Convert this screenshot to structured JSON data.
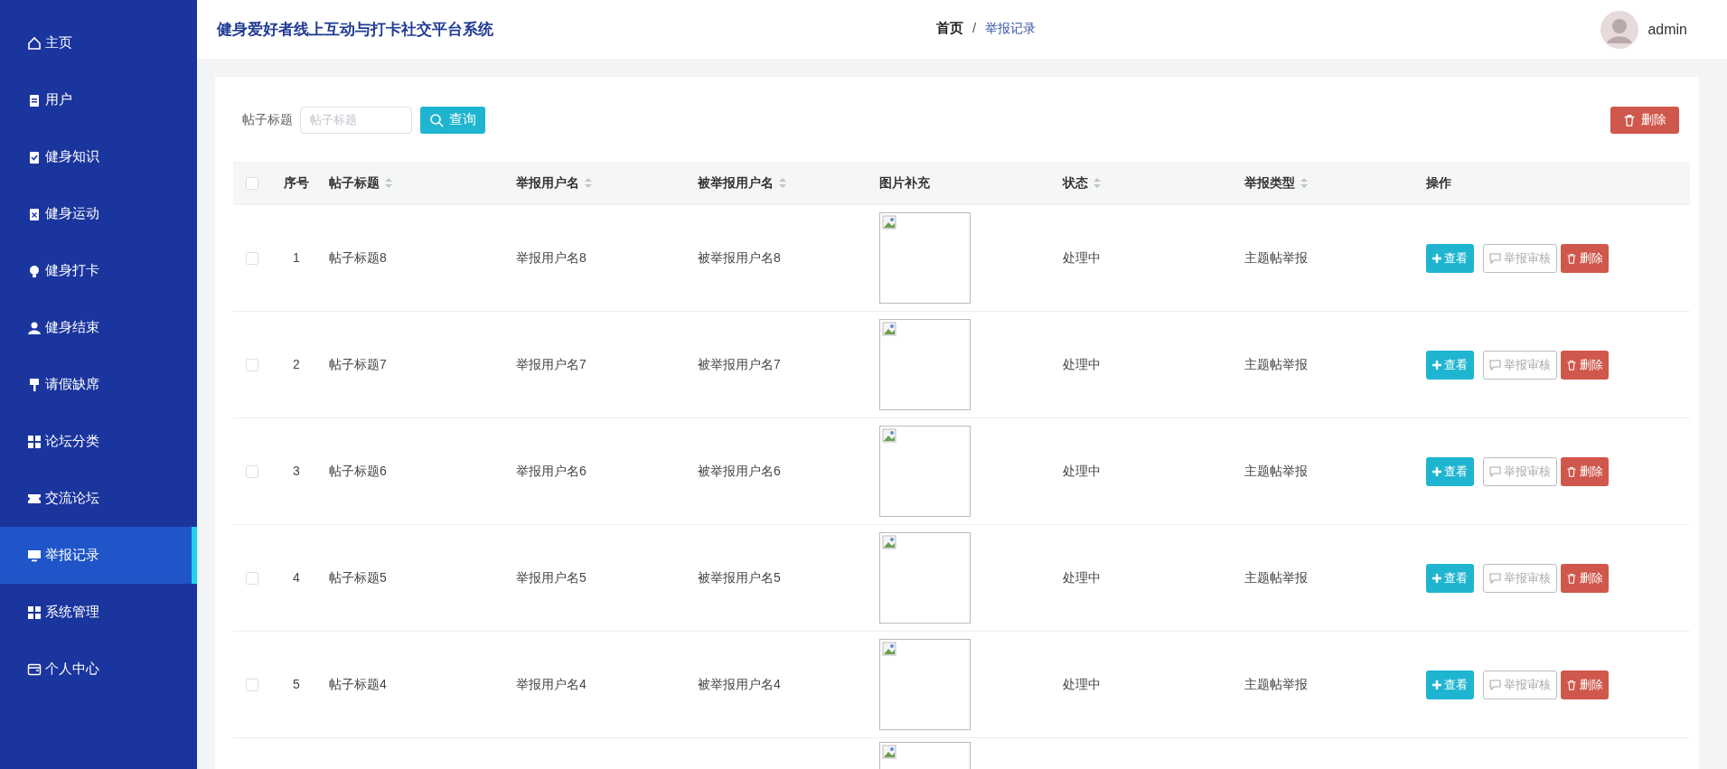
{
  "sidebar": {
    "items": [
      {
        "label": "主页",
        "selected": false
      },
      {
        "label": "用户",
        "selected": false
      },
      {
        "label": "健身知识",
        "selected": false
      },
      {
        "label": "健身运动",
        "selected": false
      },
      {
        "label": "健身打卡",
        "selected": false
      },
      {
        "label": "健身结束",
        "selected": false
      },
      {
        "label": "请假缺席",
        "selected": false
      },
      {
        "label": "论坛分类",
        "selected": false
      },
      {
        "label": "交流论坛",
        "selected": false
      },
      {
        "label": "举报记录",
        "selected": true
      },
      {
        "label": "系统管理",
        "selected": false
      },
      {
        "label": "个人中心",
        "selected": false
      }
    ]
  },
  "header": {
    "title": "健身爱好者线上互动与打卡社交平台系统",
    "breadcrumb": [
      "首页",
      "/",
      "举报记录"
    ],
    "user": "admin"
  },
  "search": {
    "label": "帖子标题",
    "placeholder": "帖子标题",
    "button": "查询",
    "delete_button": "删除"
  },
  "table": {
    "select_all_checked": false,
    "columns": [
      {
        "label": "序号",
        "sortable": false
      },
      {
        "label": "帖子标题",
        "sortable": true
      },
      {
        "label": "举报用户名",
        "sortable": true
      },
      {
        "label": "被举报用户名",
        "sortable": true
      },
      {
        "label": "图片补充",
        "sortable": false
      },
      {
        "label": "状态",
        "sortable": true
      },
      {
        "label": "举报类型",
        "sortable": true
      },
      {
        "label": "操作",
        "sortable": false
      }
    ],
    "rows": [
      {
        "checked": false,
        "cells": [
          "1",
          "帖子标题8",
          "举报用户名8",
          "被举报用户名8",
          "",
          "处理中",
          "主题帖举报"
        ],
        "actions": [
          "查看",
          "举报审核",
          "删除"
        ]
      },
      {
        "checked": false,
        "cells": [
          "2",
          "帖子标题7",
          "举报用户名7",
          "被举报用户名7",
          "",
          "处理中",
          "主题帖举报"
        ],
        "actions": [
          "查看",
          "举报审核",
          "删除"
        ]
      },
      {
        "checked": false,
        "cells": [
          "3",
          "帖子标题6",
          "举报用户名6",
          "被举报用户名6",
          "",
          "处理中",
          "主题帖举报"
        ],
        "actions": [
          "查看",
          "举报审核",
          "删除"
        ]
      },
      {
        "checked": false,
        "cells": [
          "4",
          "帖子标题5",
          "举报用户名5",
          "被举报用户名5",
          "",
          "处理中",
          "主题帖举报"
        ],
        "actions": [
          "查看",
          "举报审核",
          "删除"
        ]
      },
      {
        "checked": false,
        "cells": [
          "5",
          "帖子标题4",
          "举报用户名4",
          "被举报用户名4",
          "",
          "处理中",
          "主题帖举报"
        ],
        "actions": [
          "查看",
          "举报审核",
          "删除"
        ]
      }
    ],
    "cut_off_row": {
      "kind": "image"
    }
  }
}
